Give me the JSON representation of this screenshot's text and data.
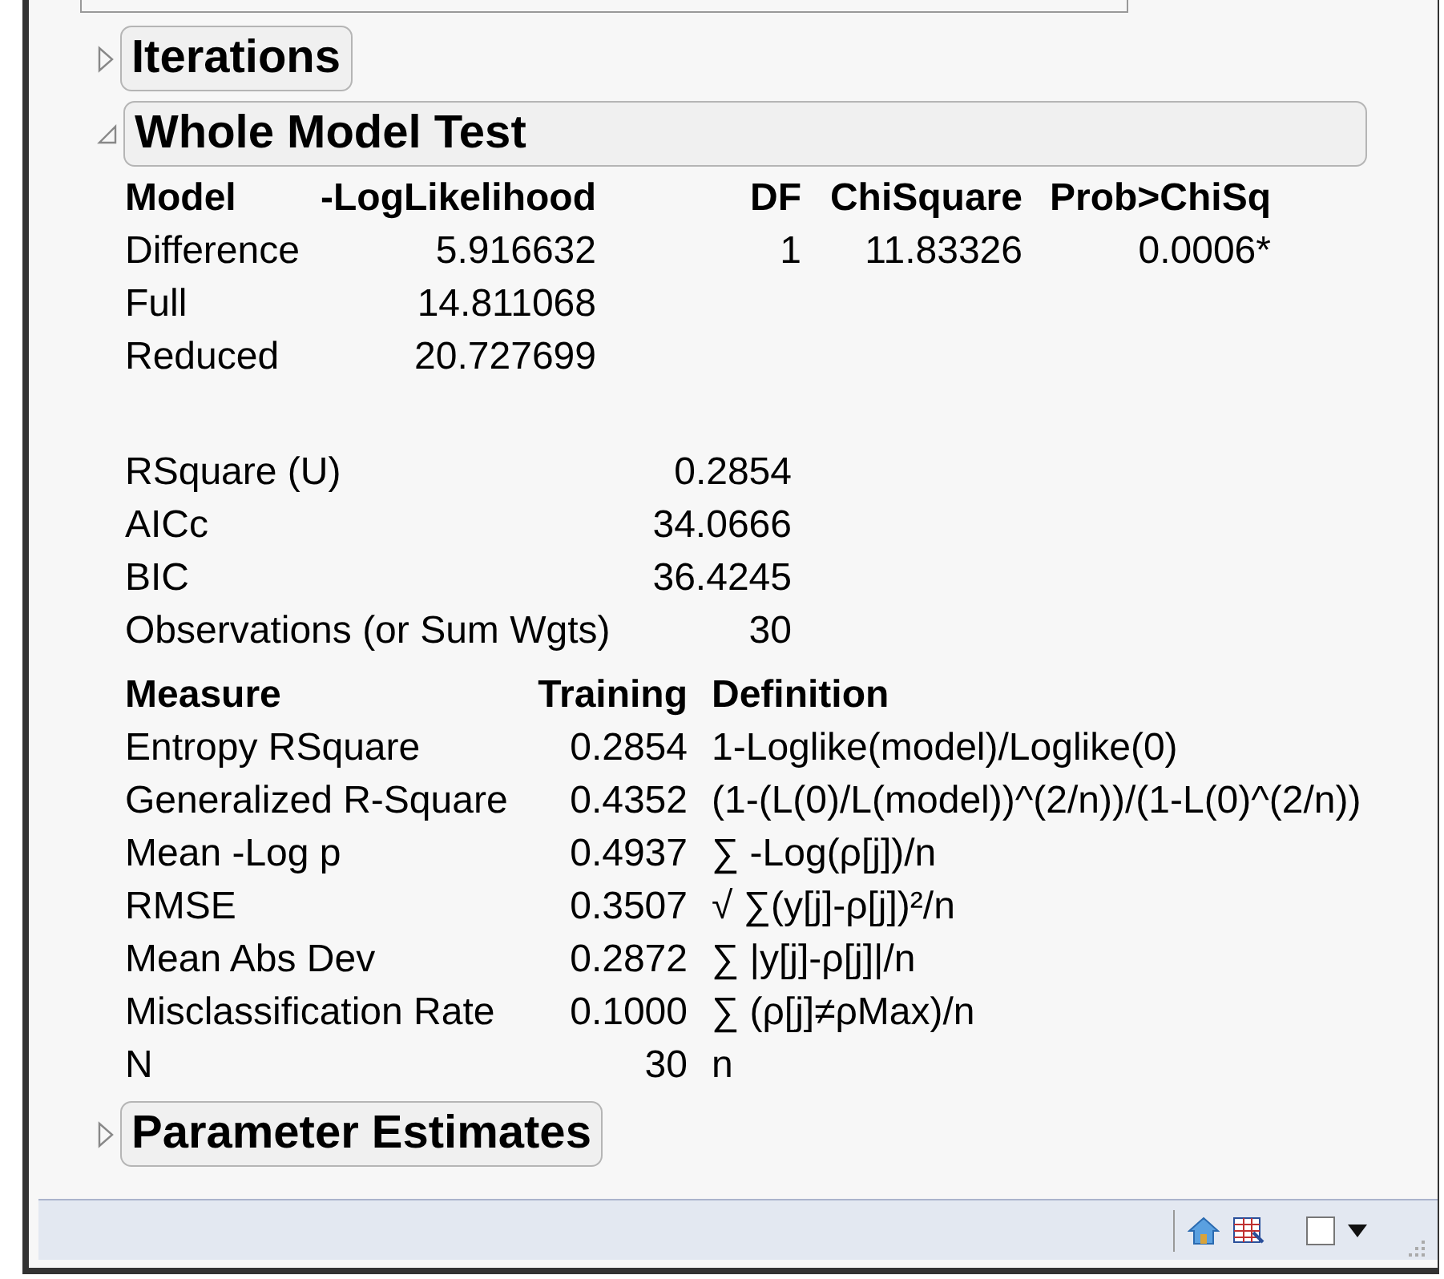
{
  "sections": [
    {
      "title": "Iterations",
      "expanded": false
    },
    {
      "title": "Whole Model Test",
      "expanded": true,
      "test_table": {
        "columns": [
          "Model",
          "-LogLikelihood",
          "DF",
          "ChiSquare",
          "Prob>ChiSq"
        ],
        "rows": [
          [
            "Difference",
            "5.916632",
            "1",
            "11.83326",
            "0.0006*"
          ],
          [
            "Full",
            "14.811068"
          ],
          [
            "Reduced",
            "20.727699"
          ]
        ]
      },
      "fit_stats": [
        [
          "RSquare (U)",
          "0.2854"
        ],
        [
          "AICc",
          "34.0666"
        ],
        [
          "BIC",
          "36.4245"
        ],
        [
          "Observations (or Sum Wgts)",
          "30"
        ]
      ],
      "measures": {
        "columns": [
          "Measure",
          "Training",
          "Definition"
        ],
        "rows": [
          [
            "Entropy RSquare",
            "0.2854",
            "1-Loglike(model)/Loglike(0)"
          ],
          [
            "Generalized R-Square",
            "0.4352",
            "(1-(L(0)/L(model))^(2/n))/(1-L(0)^(2/n))"
          ],
          [
            "Mean -Log p",
            "0.4937",
            "∑ -Log(ρ[j])/n"
          ],
          [
            "RMSE",
            "0.3507",
            "√ ∑(y[j]-ρ[j])²/n"
          ],
          [
            "Mean Abs Dev",
            "0.2872",
            "∑ |y[j]-ρ[j]|/n"
          ],
          [
            "Misclassification Rate",
            "0.1000",
            "∑ (ρ[j]≠ρMax)/n"
          ],
          [
            "N",
            "30",
            "n"
          ]
        ]
      }
    },
    {
      "title": "Parameter Estimates",
      "expanded": false
    }
  ],
  "status_bar": {
    "checkbox_checked": false
  }
}
